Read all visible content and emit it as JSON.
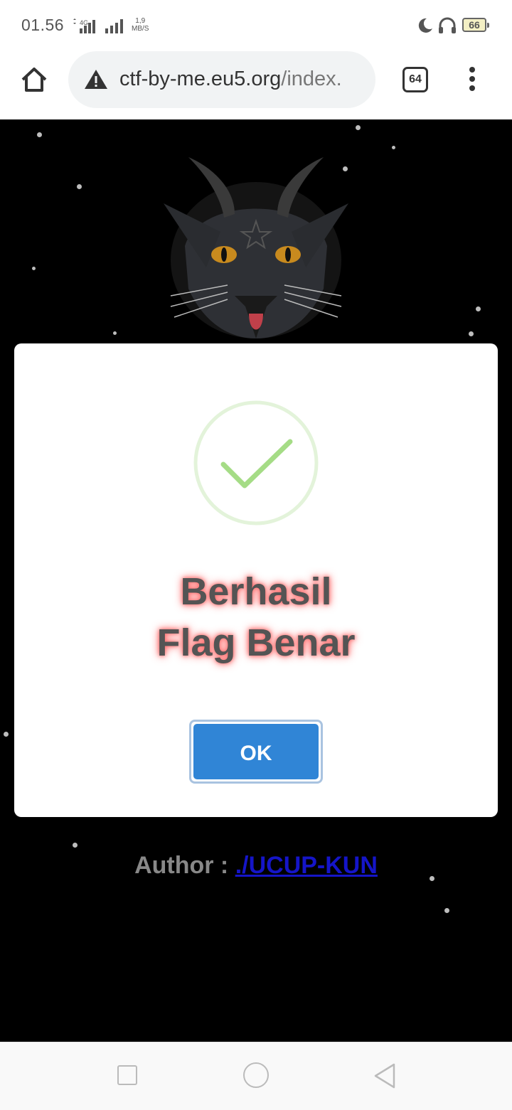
{
  "status_bar": {
    "time": "01.56",
    "network_label": "4G",
    "speed_value": "1,9",
    "speed_unit": "MB/S",
    "battery": "66"
  },
  "browser": {
    "url_host": "ctf-by-me.eu5.org",
    "url_path": "/index.",
    "tab_count": "64"
  },
  "dialog": {
    "title_line1": "Berhasil",
    "title_line2": "Flag Benar",
    "ok_label": "OK",
    "accent_color": "#3085d6",
    "success_color": "#a5dc86"
  },
  "footer": {
    "author_label": "Author :",
    "author_link": "./UCUP-KUN"
  },
  "icons": [
    "home-icon",
    "warning-icon",
    "tabs-icon",
    "more-menu-icon",
    "success-check-icon",
    "moon-icon",
    "headphones-icon",
    "battery-icon",
    "nav-recent-icon",
    "nav-home-icon",
    "nav-back-icon"
  ]
}
